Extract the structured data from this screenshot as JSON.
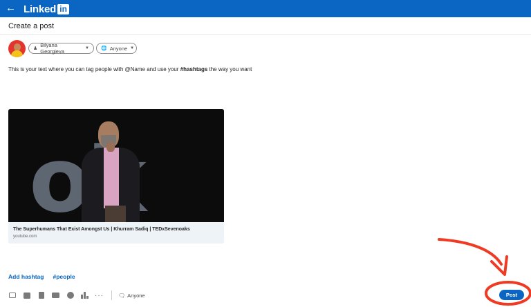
{
  "header": {
    "back_icon": "back-arrow-icon",
    "logo_text": "Linked",
    "logo_badge": "in",
    "brand_color": "#0a66c2"
  },
  "composer": {
    "title": "Create a post",
    "author_label": "Bilyana Georgieva",
    "visibility_label": "Anyone"
  },
  "post": {
    "text_before": "This is your text where you can tag people with @Name and use your ",
    "text_bold": "#hashtags",
    "text_after": " the way you want"
  },
  "link_preview": {
    "title": "The Superhumans That Exist Amongst Us | Khurram Sadiq | TEDxSevenoaks",
    "source": "youtube.com"
  },
  "hashtags": {
    "add_label": "Add hashtag",
    "suggestion": "#people"
  },
  "toolbar": {
    "icons": [
      "photo-icon",
      "video-icon",
      "document-icon",
      "job-icon",
      "celebrate-icon",
      "poll-icon",
      "more-icon"
    ],
    "more_label": "···",
    "visibility_label": "Anyone",
    "post_label": "Post"
  },
  "annotation": {
    "color": "#ef3b24"
  }
}
